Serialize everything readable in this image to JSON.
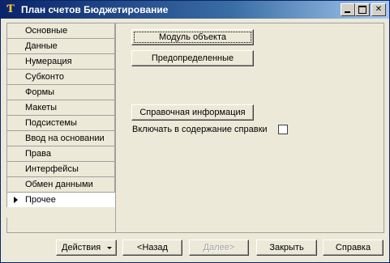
{
  "window": {
    "title": "План счетов Бюджетирование",
    "icon": "1c-app-icon",
    "min_glyph": "",
    "max_glyph": "",
    "close_glyph": "✕"
  },
  "tabs": [
    {
      "label": "Основные",
      "active": false
    },
    {
      "label": "Данные",
      "active": false
    },
    {
      "label": "Нумерация",
      "active": false
    },
    {
      "label": "Субконто",
      "active": false
    },
    {
      "label": "Формы",
      "active": false
    },
    {
      "label": "Макеты",
      "active": false
    },
    {
      "label": "Подсистемы",
      "active": false
    },
    {
      "label": "Ввод на основании",
      "active": false
    },
    {
      "label": "Права",
      "active": false
    },
    {
      "label": "Интерфейсы",
      "active": false
    },
    {
      "label": "Обмен данными",
      "active": false
    },
    {
      "label": "Прочее",
      "active": true
    }
  ],
  "panel": {
    "module_button": "Модуль объекта",
    "predefined_button": "Предопределенные",
    "help_info_button": "Справочная информация",
    "include_help_label": "Включать в содержание справки",
    "include_help_checked": false
  },
  "footer": {
    "actions": "Действия",
    "back": "<Назад",
    "next": "Далее>",
    "close": "Закрыть",
    "help": "Справка"
  },
  "colors": {
    "titlebar_start": "#0a246a",
    "titlebar_end": "#a6caf0",
    "face": "#ece9d8"
  }
}
